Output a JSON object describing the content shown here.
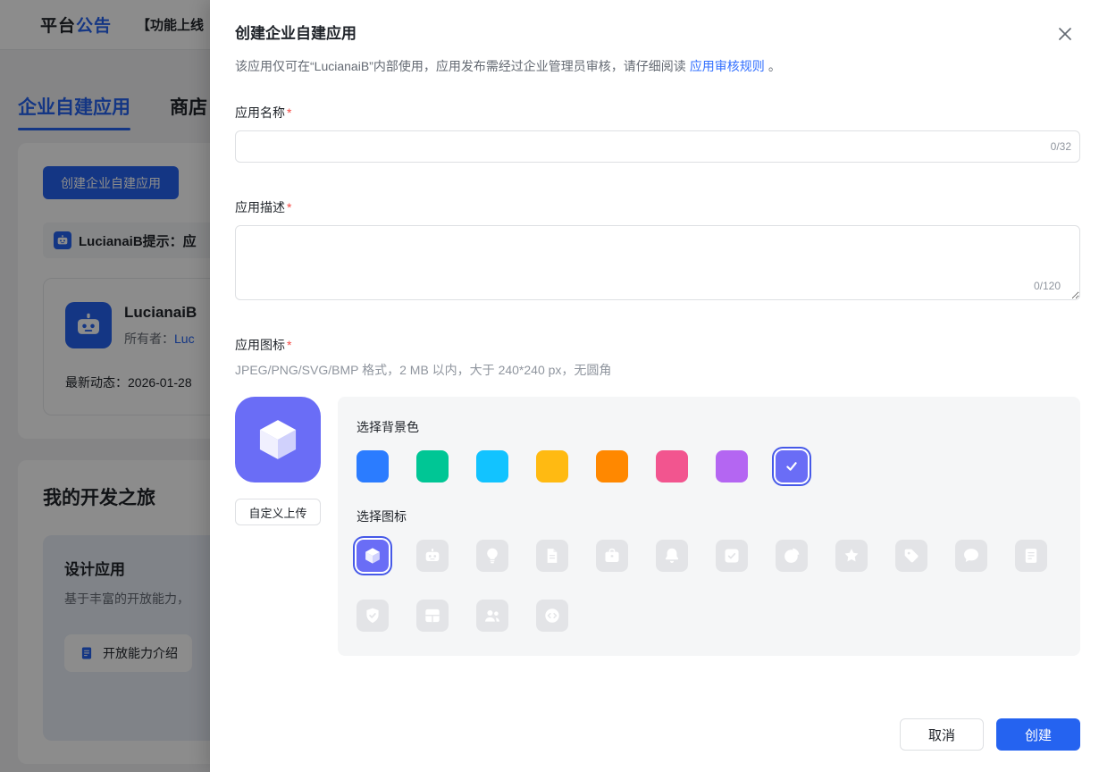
{
  "background": {
    "brand_dark": "平台",
    "brand_blue": "公告",
    "notice": "【功能上线",
    "tabs": [
      {
        "label": "企业自建应用"
      },
      {
        "label": "商店"
      }
    ],
    "create_button": "创建企业自建应用",
    "tip_text": "LucianaiB提示：应",
    "app_card": {
      "name": "LucianaiB",
      "owner_label": "所有者：",
      "owner_link": "Luc",
      "latest_label": "最新动态：",
      "latest_value": "2026-01-28"
    },
    "journey_title": "我的开发之旅",
    "design_card": {
      "title": "设计应用",
      "desc": "基于丰富的开放能力，",
      "link": "开放能力介绍"
    }
  },
  "modal": {
    "title": "创建企业自建应用",
    "subtitle_text": "该应用仅可在“LucianaiB”内部使用，应用发布需经过企业管理员审核，请仔细阅读",
    "subtitle_link": "应用审核规则",
    "subtitle_suffix": "。",
    "name_field": {
      "label": "应用名称",
      "required": "*",
      "counter": "0/32",
      "value": "",
      "placeholder": ""
    },
    "desc_field": {
      "label": "应用描述",
      "required": "*",
      "counter": "0/120",
      "value": "",
      "placeholder": ""
    },
    "icon_field": {
      "label": "应用图标",
      "required": "*",
      "hint": "JPEG/PNG/SVG/BMP 格式，2 MB 以内，大于 240*240 px，无圆角"
    },
    "upload_button": "自定义上传",
    "bg_color_label": "选择背景色",
    "colors": [
      "#2b7cff",
      "#00c695",
      "#12c3ff",
      "#ffba12",
      "#ff8800",
      "#f2558f",
      "#b466f2",
      "#6a6df6"
    ],
    "selected_color_index": 7,
    "icon_label": "选择图标",
    "icons_row1": [
      "cube",
      "robot",
      "lightbulb",
      "document",
      "briefcase",
      "bell",
      "task",
      "pie-chart",
      "star",
      "tag",
      "chat",
      "file-text"
    ],
    "icons_row2": [
      "shield-check",
      "layout",
      "people",
      "code"
    ],
    "selected_icon": "cube",
    "preview_bg": "#6a6df6",
    "cancel_button": "取消",
    "create_button": "创建"
  },
  "colors": {
    "primary": "#2563f0",
    "link": "#3370ff",
    "required_red": "#f54a45",
    "selected_ring": "#4659e8"
  }
}
